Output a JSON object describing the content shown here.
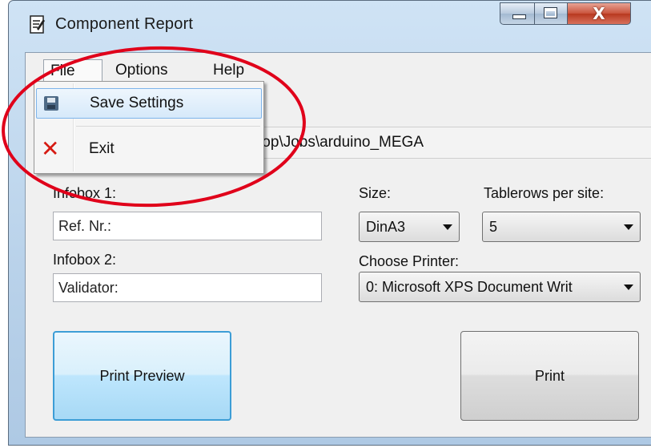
{
  "window": {
    "title": "Component Report",
    "controls": {
      "minimize": "minimize",
      "maximize": "maximize",
      "close": "X"
    }
  },
  "menubar": {
    "items": [
      "File",
      "Options",
      "Help"
    ],
    "open_menu": "File"
  },
  "file_menu": {
    "items": [
      {
        "label": "Save Settings",
        "icon": "save-icon",
        "highlighted": true
      },
      {
        "label": "Exit",
        "icon": "exit-icon",
        "highlighted": false
      }
    ]
  },
  "form": {
    "path_value": "top\\Jobs\\arduino_MEGA",
    "infobox1_label": "Infobox 1:",
    "infobox1_value": "Ref. Nr.:",
    "infobox2_label": "Infobox 2:",
    "infobox2_value": "Validator:",
    "size_label": "Size:",
    "size_value": "DinA3",
    "tablerows_label": "Tablerows per site:",
    "tablerows_value": "5",
    "printer_label": "Choose Printer:",
    "printer_value": "0: Microsoft XPS Document Writ"
  },
  "buttons": {
    "print_preview": "Print Preview",
    "print": "Print"
  },
  "annotation": {
    "shape": "ellipse",
    "color": "#e0001a"
  },
  "colors": {
    "accent": "#3c9dd6",
    "close": "#c9523b"
  }
}
